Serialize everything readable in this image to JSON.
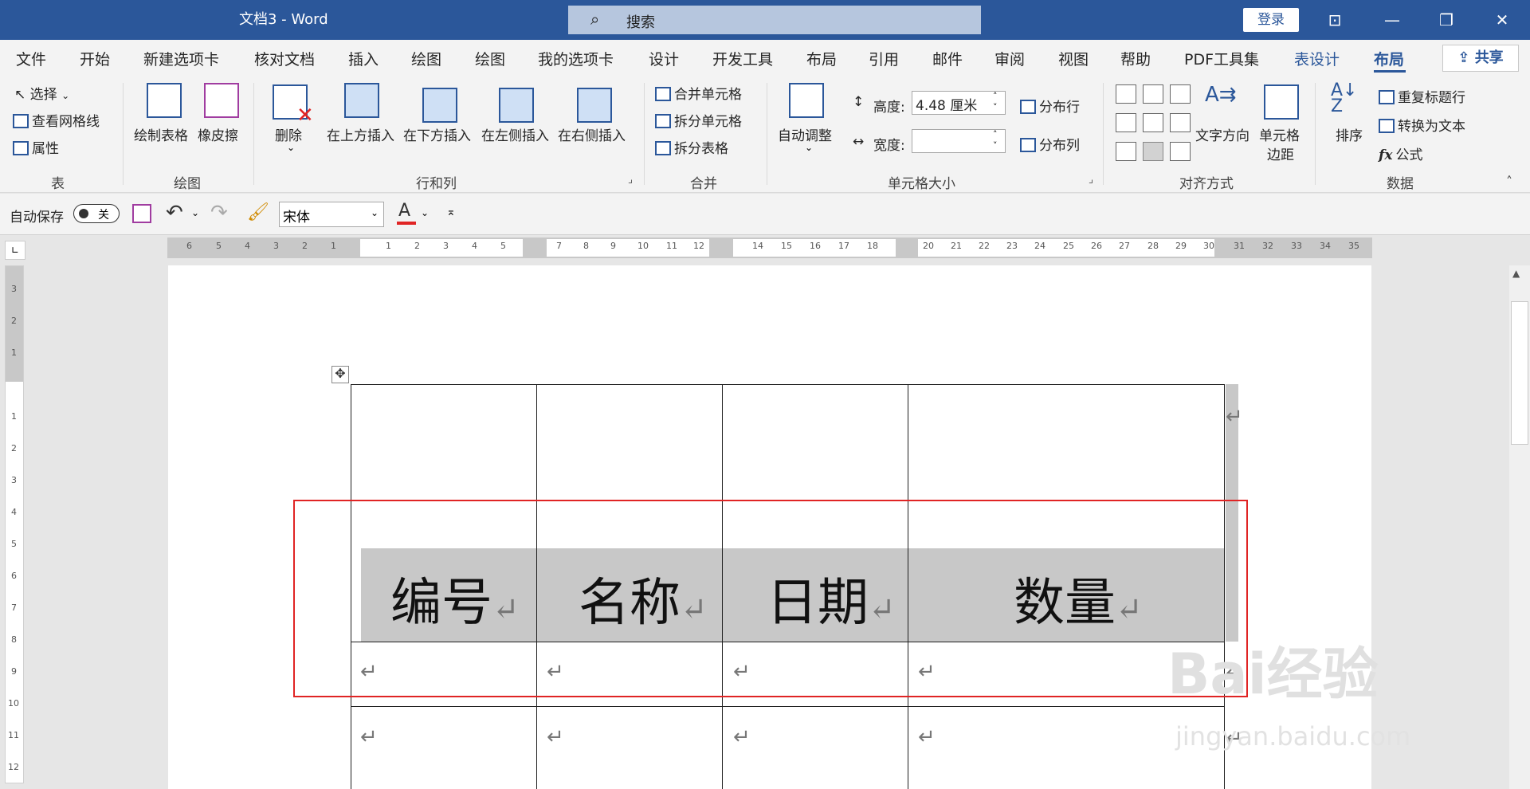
{
  "titlebar": {
    "doc_title": "文档3  -  Word",
    "search_placeholder": "搜索",
    "login_label": "登录"
  },
  "menu": {
    "tabs": [
      "文件",
      "开始",
      "新建选项卡",
      "核对文档",
      "插入",
      "绘图",
      "绘图",
      "我的选项卡",
      "设计",
      "开发工具",
      "布局",
      "引用",
      "邮件",
      "审阅",
      "视图",
      "帮助",
      "PDF工具集"
    ],
    "context_tabs": [
      "表设计",
      "布局"
    ],
    "share_label": "共享"
  },
  "ribbon": {
    "table_group": {
      "select": "选择",
      "view_gridlines": "查看网格线",
      "properties": "属性",
      "label": "表"
    },
    "draw_group": {
      "draw_table": "绘制表格",
      "eraser": "橡皮擦",
      "label": "绘图"
    },
    "rowscols_group": {
      "delete": "删除",
      "insert_above": "在上方插入",
      "insert_below": "在下方插入",
      "insert_left": "在左侧插入",
      "insert_right": "在右侧插入",
      "label": "行和列"
    },
    "merge_group": {
      "merge_cells": "合并单元格",
      "split_cells": "拆分单元格",
      "split_table": "拆分表格",
      "label": "合并"
    },
    "cellsize_group": {
      "autofit": "自动调整",
      "height_label": "高度:",
      "height_value": "4.48 厘米",
      "width_label": "宽度:",
      "width_value": "",
      "distribute_rows": "分布行",
      "distribute_cols": "分布列",
      "label": "单元格大小"
    },
    "align_group": {
      "text_direction": "文字方向",
      "cell_margins_1": "单元格",
      "cell_margins_2": "边距",
      "label": "对齐方式"
    },
    "data_group": {
      "sort": "排序",
      "repeat_header": "重复标题行",
      "convert_to_text": "转换为文本",
      "formula": "公式",
      "label": "数据"
    }
  },
  "qat": {
    "autosave_label": "自动保存",
    "autosave_state": "关",
    "font_name": "宋体",
    "font_color_letter": "A"
  },
  "ruler": {
    "left_numbers": [
      "6",
      "5",
      "4",
      "3",
      "2",
      "1"
    ],
    "seg1": [
      "1",
      "2",
      "3",
      "4",
      "5"
    ],
    "seg2": [
      "7",
      "8",
      "9",
      "10",
      "11",
      "12"
    ],
    "seg3": [
      "14",
      "15",
      "16",
      "17",
      "18"
    ],
    "seg4": [
      "20",
      "21",
      "22",
      "23",
      "24",
      "25",
      "26",
      "27",
      "28",
      "29",
      "30"
    ],
    "right_numbers": [
      "31",
      "32",
      "33",
      "34",
      "35"
    ],
    "vertical_numbers": [
      "3",
      "2",
      "1",
      "1",
      "2",
      "3",
      "4",
      "5",
      "6",
      "7",
      "8",
      "9",
      "10",
      "11",
      "12"
    ]
  },
  "table": {
    "headers": [
      "编号",
      "名称",
      "日期",
      "数量"
    ],
    "return_mark": "↵"
  },
  "watermark": {
    "logo_text": "Bai经验",
    "url": "jingyan.baidu.com"
  },
  "colors": {
    "title_blue": "#2b579a",
    "highlight_red": "#e02424",
    "header_grey": "#c8c8c8"
  }
}
